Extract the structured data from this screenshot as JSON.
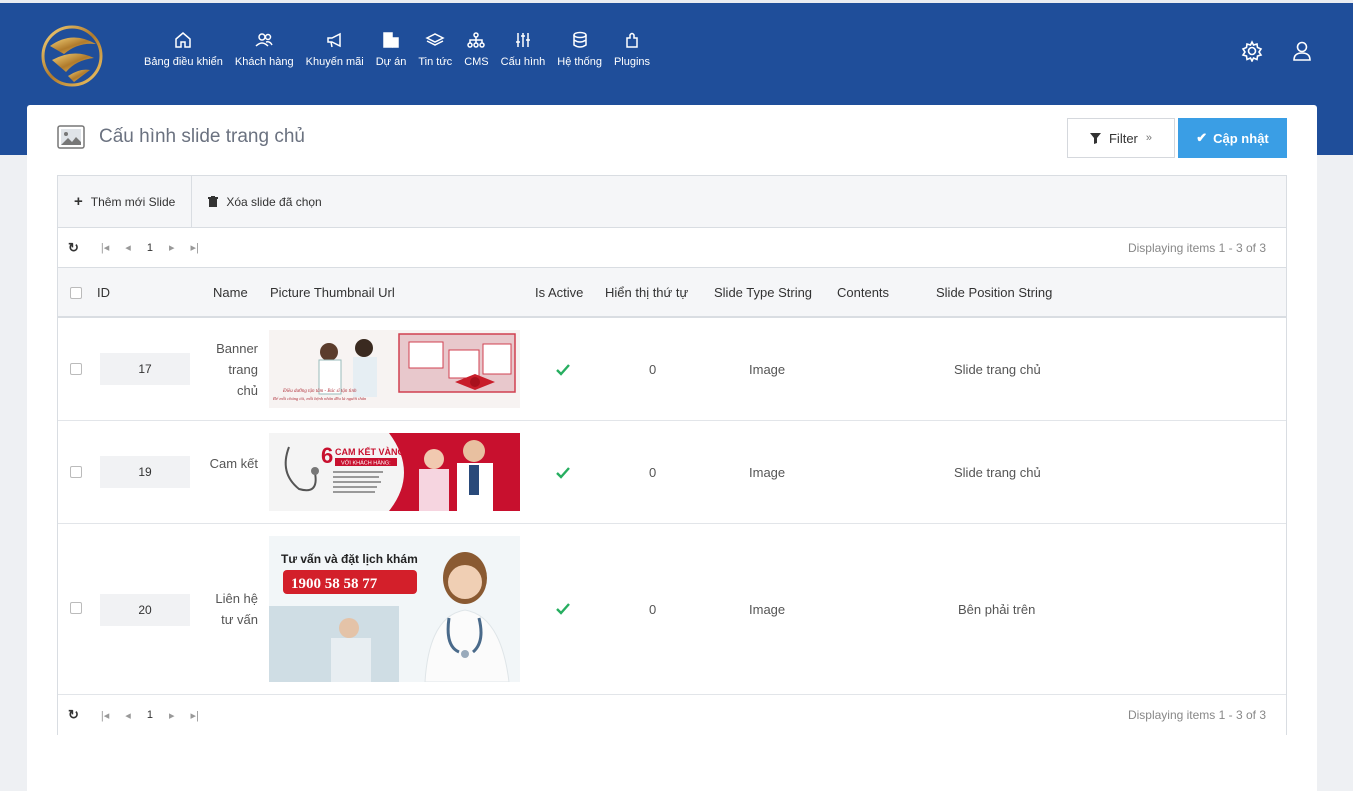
{
  "nav": {
    "items": [
      {
        "label": "Bảng điều khiển",
        "icon": "home-icon"
      },
      {
        "label": "Khách hàng",
        "icon": "users-icon"
      },
      {
        "label": "Khuyến mãi",
        "icon": "megaphone-icon"
      },
      {
        "label": "Dự án",
        "icon": "building-icon"
      },
      {
        "label": "Tin tức",
        "icon": "layers-icon"
      },
      {
        "label": "CMS",
        "icon": "sitemap-icon"
      },
      {
        "label": "Cấu hình",
        "icon": "sliders-icon"
      },
      {
        "label": "Hệ thống",
        "icon": "database-icon"
      },
      {
        "label": "Plugins",
        "icon": "plugin-icon"
      }
    ]
  },
  "header": {
    "title": "Cấu hình slide trang chủ",
    "filter_label": "Filter",
    "update_label": "Cập nhật"
  },
  "toolbar": {
    "add_label": "Thêm mới Slide",
    "delete_label": "Xóa slide đã chọn"
  },
  "pager": {
    "page": "1",
    "info": "Displaying items 1 - 3 of 3"
  },
  "columns": {
    "id": "ID",
    "name": "Name",
    "thumb": "Picture Thumbnail Url",
    "active": "Is Active",
    "order": "Hiển thị thứ tự",
    "type": "Slide Type String",
    "contents": "Contents",
    "position": "Slide Position String"
  },
  "rows": [
    {
      "id": "17",
      "name": "Banner trang chủ",
      "order": "0",
      "type": "Image",
      "position": "Slide trang chủ",
      "thumb_text": [
        "Điều dưỡng tận tâm - Bác sĩ tận tình",
        "Để mỗi chúng tôi, mỗi bệnh nhân đều là người thân"
      ]
    },
    {
      "id": "19",
      "name": "Cam kết",
      "order": "0",
      "type": "Image",
      "position": "Slide trang chủ",
      "thumb_text": [
        "6",
        "CAM KẾT VÀNG",
        "VỚI KHÁCH HÀNG:"
      ]
    },
    {
      "id": "20",
      "name": "Liên hệ tư vấn",
      "order": "0",
      "type": "Image",
      "position": "Bên phải trên",
      "thumb_text": [
        "Tư vấn và đặt lịch khám",
        "1900 58 58 77"
      ]
    }
  ],
  "colors": {
    "topbar": "#1f4e9a",
    "primary": "#3a9ee5",
    "check": "#27ae60"
  }
}
